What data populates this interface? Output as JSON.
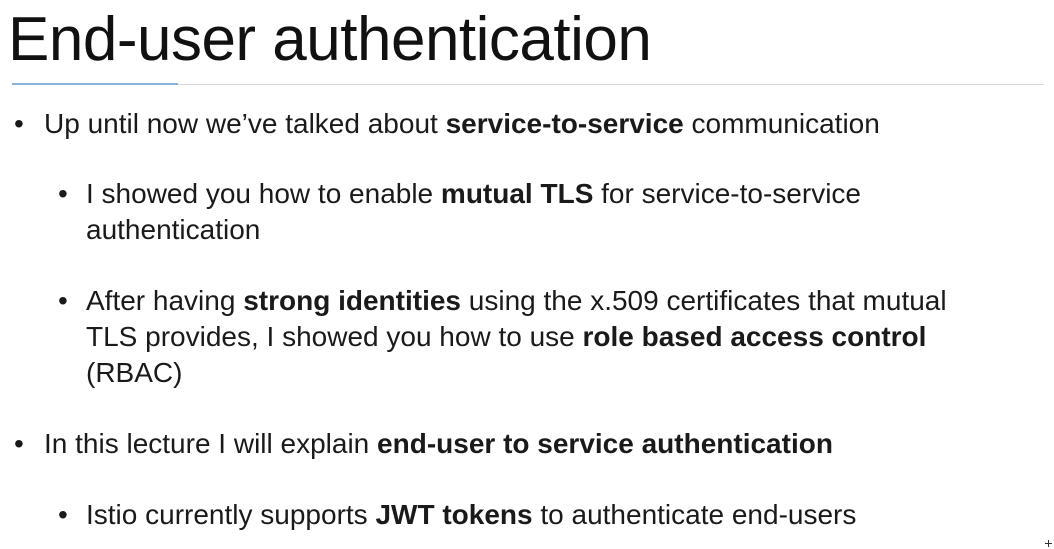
{
  "slide": {
    "title": "End-user authentication",
    "bullets": [
      {
        "level": 1,
        "lines": [
          [
            {
              "text": "Up until now we’ve talked about ",
              "bold": false
            },
            {
              "text": "service-to-service",
              "bold": true
            },
            {
              "text": " communication",
              "bold": false
            }
          ]
        ]
      },
      {
        "level": 2,
        "lines": [
          [
            {
              "text": "I showed you how to enable ",
              "bold": false
            },
            {
              "text": "mutual TLS",
              "bold": true
            },
            {
              "text": " for service-to-service",
              "bold": false
            }
          ],
          [
            {
              "text": "authentication",
              "bold": false
            }
          ]
        ]
      },
      {
        "level": 2,
        "lines": [
          [
            {
              "text": "After having ",
              "bold": false
            },
            {
              "text": "strong identities",
              "bold": true
            },
            {
              "text": " using the x.509 certificates that mutual",
              "bold": false
            }
          ],
          [
            {
              "text": "TLS provides, I showed you how to use ",
              "bold": false
            },
            {
              "text": "role based access control",
              "bold": true
            }
          ],
          [
            {
              "text": "(RBAC)",
              "bold": false
            }
          ]
        ]
      },
      {
        "level": 1,
        "lines": [
          [
            {
              "text": "In this lecture I will explain ",
              "bold": false
            },
            {
              "text": "end-user to service authentication",
              "bold": true
            }
          ]
        ]
      },
      {
        "level": 2,
        "lines": [
          [
            {
              "text": "Istio currently supports ",
              "bold": false
            },
            {
              "text": "JWT tokens",
              "bold": true
            },
            {
              "text": " to authenticate end-users",
              "bold": false
            }
          ]
        ]
      }
    ]
  }
}
